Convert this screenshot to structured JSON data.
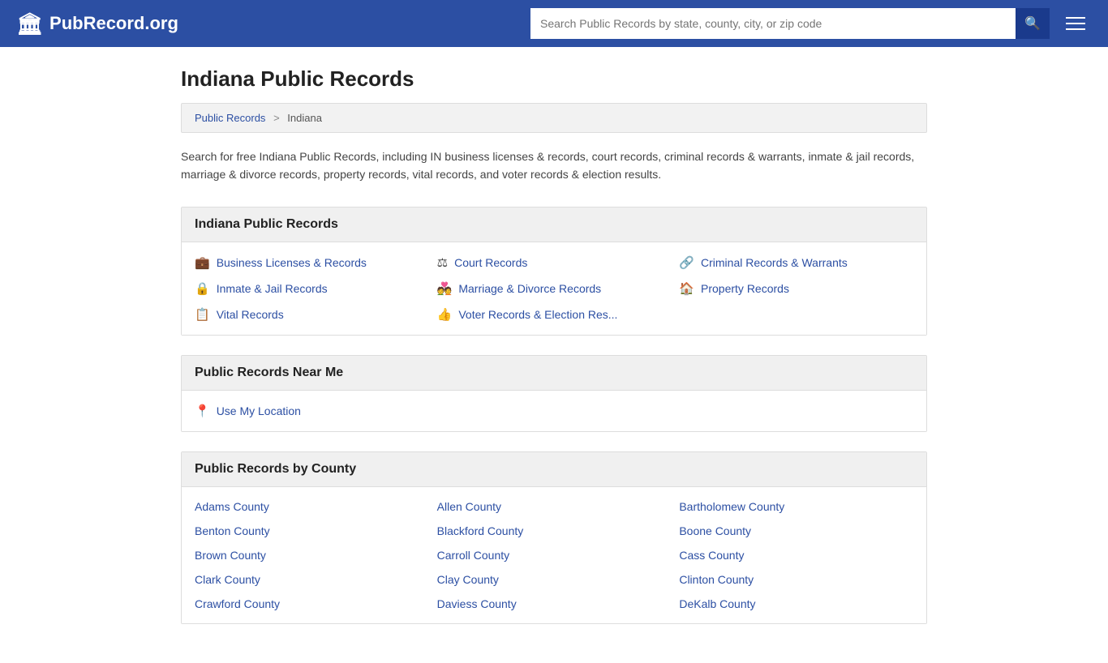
{
  "header": {
    "logo_icon": "🏛",
    "logo_text": "PubRecord.org",
    "search_placeholder": "Search Public Records by state, county, city, or zip code",
    "search_button_icon": "🔍",
    "menu_button_label": "Menu"
  },
  "page": {
    "title": "Indiana Public Records",
    "breadcrumb": {
      "home": "Public Records",
      "separator": ">",
      "current": "Indiana"
    },
    "description": "Search for free Indiana Public Records, including IN business licenses & records, court records, criminal records & warrants, inmate & jail records, marriage & divorce records, property records, vital records, and voter records & election results."
  },
  "records_section": {
    "heading": "Indiana Public Records",
    "items": [
      {
        "label": "Business Licenses & Records",
        "icon": "💼"
      },
      {
        "label": "Court Records",
        "icon": "⚖"
      },
      {
        "label": "Criminal Records & Warrants",
        "icon": "🔗"
      },
      {
        "label": "Inmate & Jail Records",
        "icon": "🔒"
      },
      {
        "label": "Marriage & Divorce Records",
        "icon": "💑"
      },
      {
        "label": "Property Records",
        "icon": "🏠"
      },
      {
        "label": "Vital Records",
        "icon": "📋"
      },
      {
        "label": "Voter Records & Election Res...",
        "icon": "👍"
      }
    ]
  },
  "near_me_section": {
    "heading": "Public Records Near Me",
    "location_label": "Use My Location",
    "location_icon": "📍"
  },
  "county_section": {
    "heading": "Public Records by County",
    "counties": [
      "Adams County",
      "Allen County",
      "Bartholomew County",
      "Benton County",
      "Blackford County",
      "Boone County",
      "Brown County",
      "Carroll County",
      "Cass County",
      "Clark County",
      "Clay County",
      "Clinton County",
      "Crawford County",
      "Daviess County",
      "DeKalb County"
    ]
  }
}
